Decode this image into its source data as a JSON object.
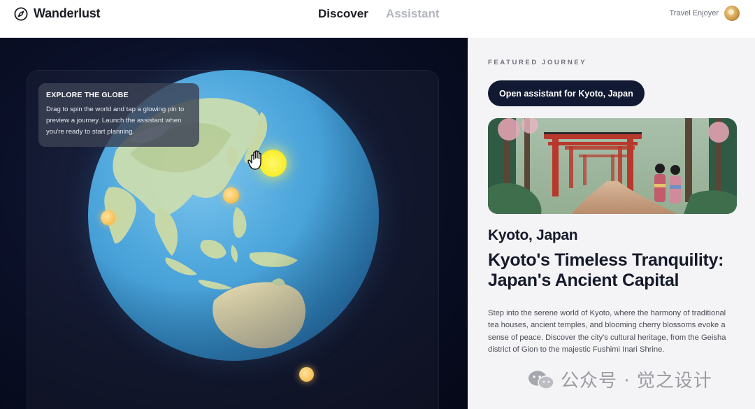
{
  "header": {
    "brand_name": "Wanderlust",
    "nav": [
      {
        "label": "Discover",
        "active": true
      },
      {
        "label": "Assistant",
        "active": false
      }
    ],
    "user_name": "Travel Enjoyer"
  },
  "globe_panel": {
    "tooltip_title": "EXPLORE THE GLOBE",
    "tooltip_body": "Drag to spin the world and tap a glowing pin to preview a journey. Launch the assistant when you're ready to start planning."
  },
  "featured": {
    "kicker": "FEATURED JOURNEY",
    "cta_label": "Open assistant for Kyoto, Japan",
    "city": "Kyoto, Japan",
    "headline": "Kyoto's Timeless Tranquility: Japan's Ancient Capital",
    "description": "Step into the serene world of Kyoto, where the harmony of traditional tea houses, ancient temples, and blooming cherry blossoms evoke a sense of peace. Discover the city's cultural heritage, from the Geisha district of Gion to the majestic Fushimi Inari Shrine."
  },
  "watermark": {
    "text": "公众号 · 觉之设计"
  },
  "colors": {
    "accent_dark": "#121a33",
    "pin": "#f7c45b",
    "pin_active": "#f7ec2a",
    "ocean": "#4ea7dc"
  }
}
